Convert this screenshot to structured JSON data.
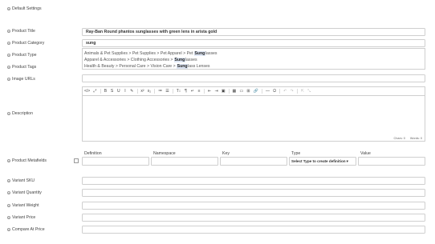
{
  "sections": {
    "default_settings": "Default Settings"
  },
  "labels": {
    "product_title": "Product Title",
    "product_category": "Product Category",
    "product_type": "Product Type",
    "product_tags": "Product Tags",
    "image_urls": "Image URLs",
    "description": "Description",
    "product_metafields": "Product Metafields",
    "variant_sku": "Variant SKU",
    "variant_quantity": "Variant Quantity",
    "variant_weight": "Variant Weight",
    "variant_price": "Variant Price",
    "compare_at_price": "Compare At Price"
  },
  "help_icon": "question-circle-icon",
  "fields": {
    "product_title_value": "Ray-Ban Round phantos sunglasses with green lens in arista gold",
    "product_category_value": "sung"
  },
  "category_dropdown": [
    {
      "before": "Animals & Pet Supplies > Pet Supplies > Pet Apparel > Pet ",
      "match": "Sung",
      "after": "lasses"
    },
    {
      "before": "Apparel & Accessories > Clothing Accessories > ",
      "match": "Sung",
      "after": "lasses"
    },
    {
      "before": "Health & Beauty > Personal Care > Vision Care > ",
      "match": "Sung",
      "after": "lass Lenses"
    }
  ],
  "editor": {
    "toolbar": [
      "</>",
      "⤢",
      "B",
      "S",
      "U",
      "I",
      "✎",
      "x²",
      "x₂",
      "≔",
      "☰",
      "T↕",
      "¶",
      "↵",
      "≡",
      "⇤",
      "⇥",
      "▣",
      "▦",
      "▭",
      "⊞",
      "🔗",
      "—",
      "Ω",
      "↶",
      "↷",
      "⇱",
      "⤡"
    ],
    "chars_label": "Chars: 0",
    "words_label": "Words: 0"
  },
  "metafields": {
    "headers": [
      "Definition",
      "Namespace",
      "Key",
      "Type",
      "Value"
    ],
    "type_placeholder": "Select Type to create definition"
  },
  "colors": {
    "highlight": "#dfe7f5",
    "border": "#cfcfcf"
  }
}
